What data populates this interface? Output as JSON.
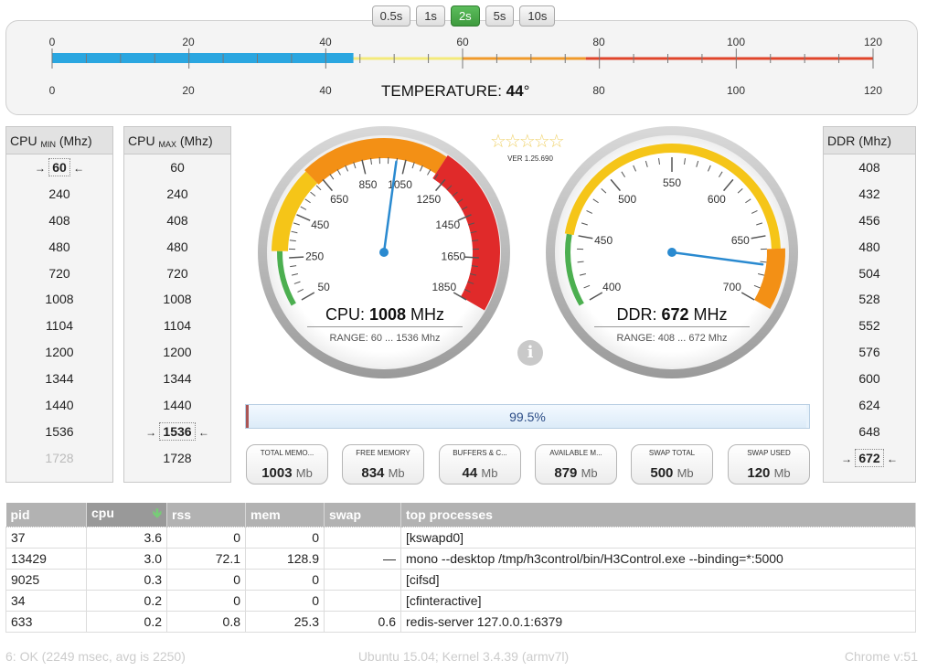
{
  "intervals": [
    {
      "label": "0.5s",
      "active": false
    },
    {
      "label": "1s",
      "active": false
    },
    {
      "label": "2s",
      "active": true
    },
    {
      "label": "5s",
      "active": false
    },
    {
      "label": "10s",
      "active": false
    }
  ],
  "temperature": {
    "ticks": [
      "0",
      "20",
      "40",
      "60",
      "80",
      "100",
      "120"
    ],
    "label": "TEMPERATURE:",
    "value": "44",
    "unit": "°",
    "fraction": 0.367,
    "colors": {
      "bar": "#2aa6e0",
      "yellow": "#f3ea7a",
      "orange": "#f09a2a",
      "red": "#e0452a"
    }
  },
  "cpu_min": {
    "title": "CPU",
    "sub": "MIN",
    "unit": "(Mhz)",
    "items": [
      "60",
      "240",
      "408",
      "480",
      "720",
      "1008",
      "1104",
      "1200",
      "1344",
      "1440",
      "1536",
      "1728"
    ],
    "selected": 0,
    "dimmed": [
      11
    ]
  },
  "cpu_max": {
    "title": "CPU",
    "sub": "MAX",
    "unit": "(Mhz)",
    "items": [
      "60",
      "240",
      "408",
      "480",
      "720",
      "1008",
      "1104",
      "1200",
      "1344",
      "1440",
      "1536",
      "1728"
    ],
    "selected": 10,
    "dimmed": []
  },
  "ddr_list": {
    "title": "DDR (Mhz)",
    "items": [
      "408",
      "432",
      "456",
      "480",
      "504",
      "528",
      "552",
      "576",
      "600",
      "624",
      "648",
      "672"
    ],
    "selected": 11
  },
  "cpu_gauge": {
    "label": "CPU:",
    "value": "1008",
    "unit": "MHz",
    "range": "RANGE: 60 ... 1536 Mhz",
    "ticks": [
      "50",
      "250",
      "450",
      "650",
      "850",
      "1050",
      "1250",
      "1450",
      "1650",
      "1850"
    ],
    "needle_value": 1008,
    "min": 50,
    "max": 1850
  },
  "ddr_gauge": {
    "label": "DDR:",
    "value": "672",
    "unit": "MHz",
    "range": "RANGE: 408 ... 672 Mhz",
    "ticks": [
      "400",
      "450",
      "500",
      "550",
      "600",
      "650",
      "700"
    ],
    "needle_value": 672,
    "min": 400,
    "max": 700
  },
  "version": "VER 1.25.690",
  "progress": {
    "text": "99.5%",
    "value": 99.5
  },
  "memory": [
    {
      "label": "TOTAL MEMO...",
      "value": "1003",
      "unit": "Mb"
    },
    {
      "label": "FREE MEMORY",
      "value": "834",
      "unit": "Mb"
    },
    {
      "label": "BUFFERS & C...",
      "value": "44",
      "unit": "Mb"
    },
    {
      "label": "AVAILABLE M...",
      "value": "879",
      "unit": "Mb"
    },
    {
      "label": "SWAP TOTAL",
      "value": "500",
      "unit": "Mb"
    },
    {
      "label": "SWAP USED",
      "value": "120",
      "unit": "Mb"
    }
  ],
  "processes": {
    "columns": [
      "pid",
      "cpu",
      "rss",
      "mem",
      "swap",
      "top processes"
    ],
    "sort_arrow": "🡻",
    "rows": [
      [
        "37",
        "3.6",
        "0",
        "0",
        "",
        "[kswapd0]"
      ],
      [
        "13429",
        "3.0",
        "72.1",
        "128.9",
        "—",
        "mono --desktop /tmp/h3control/bin/H3Control.exe --binding=*:5000"
      ],
      [
        "9025",
        "0.3",
        "0",
        "0",
        "",
        "[cifsd]"
      ],
      [
        "34",
        "0.2",
        "0",
        "0",
        "",
        "[cfinteractive]"
      ],
      [
        "633",
        "0.2",
        "0.8",
        "25.3",
        "0.6",
        "redis-server 127.0.0.1:6379"
      ]
    ]
  },
  "footer": {
    "status": "6: OK (2249 msec, avg is 2250)",
    "os": "Ubuntu 15.04; Kernel 3.4.39 (armv7l)",
    "browser": "Chrome v:51"
  }
}
